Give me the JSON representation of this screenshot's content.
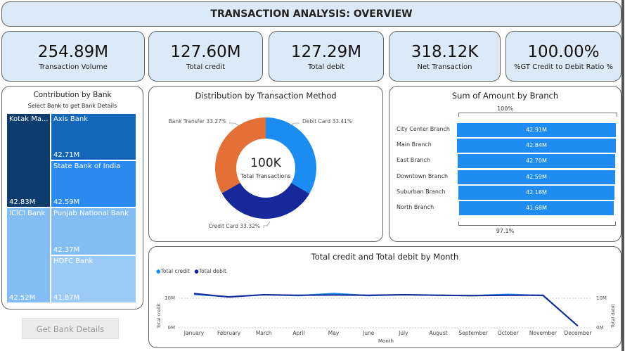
{
  "header": {
    "title": "TRANSACTION ANALYSIS: OVERVIEW"
  },
  "kpis": [
    {
      "value": "254.89M",
      "label": "Transaction Volume"
    },
    {
      "value": "127.60M",
      "label": "Total credit"
    },
    {
      "value": "127.29M",
      "label": "Total debit"
    },
    {
      "value": "318.12K",
      "label": "Net Transaction"
    },
    {
      "value": "100.00%",
      "label": "%GT Credit to Debit Ratio %"
    }
  ],
  "bank_treemap": {
    "title": "Contribution by Bank",
    "subtitle": "Select Bank to get Bank Details",
    "tiles": [
      {
        "name": "Kotak Ma...",
        "value": "42.83M",
        "color": "#0e3c6c"
      },
      {
        "name": "Axis Bank",
        "value": "42.71M",
        "color": "#1466b8"
      },
      {
        "name": "State Bank of India",
        "value": "42.59M",
        "color": "#2a8af0"
      },
      {
        "name": "ICICI Bank",
        "value": "42.52M",
        "color": "#82bef5"
      },
      {
        "name": "Punjab National Bank",
        "value": "42.37M",
        "color": "#82bef5"
      },
      {
        "name": "HDFC Bank",
        "value": "41.87M",
        "color": "#9ccaf7"
      }
    ]
  },
  "button": {
    "label": "Get Bank Details"
  },
  "donut": {
    "title": "Distribution by Transaction Method",
    "center_value": "100K",
    "center_label": "Total Transactions",
    "slices": [
      {
        "label": "Debit Card 33.41%",
        "share": 33.41,
        "color": "#1a8cf2"
      },
      {
        "label": "Credit Card 33.32%",
        "share": 33.32,
        "color": "#16289a"
      },
      {
        "label": "Bank Transfer 33.27%",
        "share": 33.27,
        "color": "#e46f37"
      }
    ]
  },
  "branch_chart": {
    "title": "Sum of Amount by Branch",
    "top_pct": "100%",
    "bottom_pct": "97.1%",
    "bars": [
      {
        "name": "City Center Branch",
        "label": "42.91M",
        "value": 42.91
      },
      {
        "name": "Main Branch",
        "label": "42.84M",
        "value": 42.84
      },
      {
        "name": "East Branch",
        "label": "42.70M",
        "value": 42.7
      },
      {
        "name": "Downtown Branch",
        "label": "42.59M",
        "value": 42.59
      },
      {
        "name": "Suburban Branch",
        "label": "42.18M",
        "value": 42.18
      },
      {
        "name": "North Branch",
        "label": "41.68M",
        "value": 41.68
      }
    ]
  },
  "line_chart": {
    "title": "Total credit and Total debit by Month",
    "legend": [
      {
        "name": "Total credit",
        "color": "#1a8cf2"
      },
      {
        "name": "Total debit",
        "color": "#16289a"
      }
    ],
    "y_left_label": "Total credit",
    "y_right_label": "Total debit",
    "y_ticks": [
      "10M",
      "0M"
    ],
    "x_label": "Month",
    "months": [
      "January",
      "February",
      "March",
      "April",
      "May",
      "June",
      "July",
      "August",
      "September",
      "October",
      "November",
      "December"
    ],
    "credit": [
      11.3,
      10.5,
      11.2,
      10.9,
      11.6,
      10.9,
      11.2,
      11.0,
      10.9,
      11.3,
      10.9,
      0.6
    ],
    "debit": [
      11.6,
      10.4,
      11.2,
      11.0,
      11.1,
      11.0,
      11.2,
      11.0,
      10.9,
      11.0,
      11.0,
      0.6
    ]
  }
}
